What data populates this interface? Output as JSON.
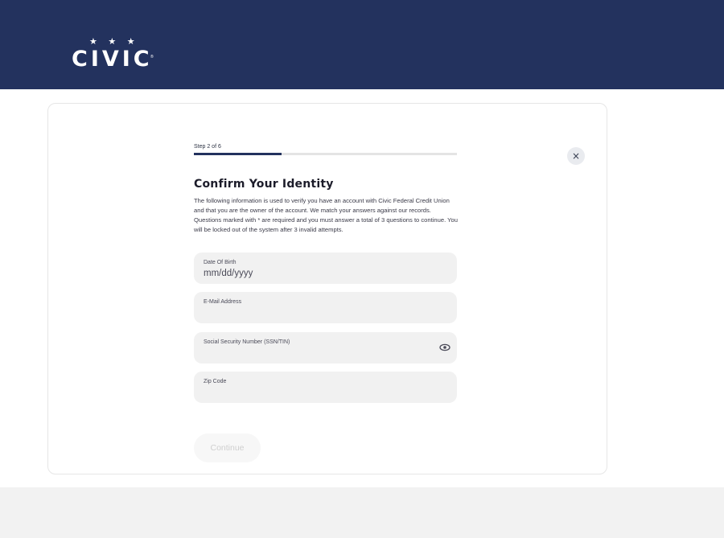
{
  "header": {
    "logo_stars": "★ ★ ★",
    "logo_text": "CIVIC",
    "logo_mark": "®"
  },
  "form": {
    "step_label": "Step 2 of 6",
    "progress_fraction": 0.333,
    "title": "Confirm Your Identity",
    "description": "The following information is used to verify you have an account with Civic Federal Credit Union and that you are the owner of the account. We match your answers against our records. Questions marked with * are required and you must answer a total of 3 questions to continue. You will be locked out of the system after 3 invalid attempts.",
    "fields": [
      {
        "label": "Date Of Birth",
        "placeholder": "mm/dd/yyyy",
        "value": ""
      },
      {
        "label": "E-Mail Address",
        "placeholder": "",
        "value": ""
      },
      {
        "label": "Social Security Number (SSN/TIN)",
        "placeholder": "",
        "value": "",
        "icon": "eye-icon"
      },
      {
        "label": "Zip Code",
        "placeholder": "",
        "value": ""
      }
    ],
    "continue_label": "Continue",
    "close_glyph": "×"
  },
  "colors": {
    "brand_navy": "#23325e",
    "field_bg": "#f1f1f1",
    "page_band": "#f2f2f2"
  }
}
